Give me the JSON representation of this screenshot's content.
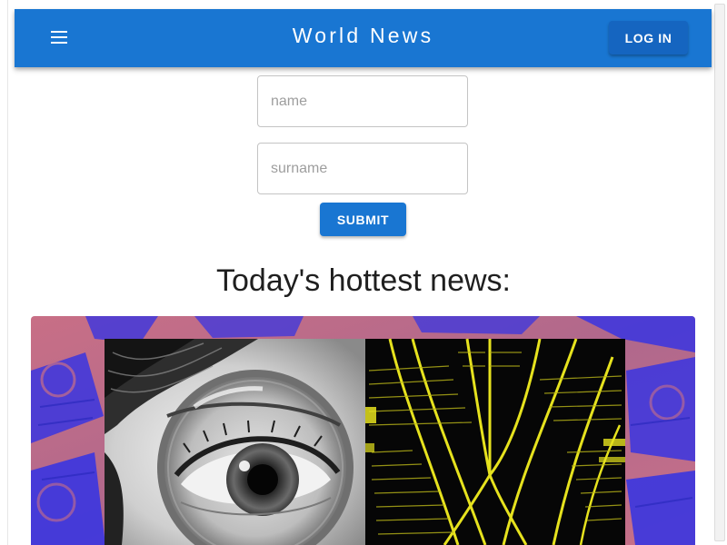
{
  "appbar": {
    "title": "World News",
    "login_label": "LOG IN",
    "menu_icon": "menu-icon",
    "color": "#1976d2"
  },
  "form": {
    "name_placeholder": "name",
    "name_value": "",
    "surname_placeholder": "surname",
    "surname_value": "",
    "submit_label": "SUBMIT"
  },
  "news": {
    "heading": "Today's hottest news:",
    "featured_image": "magnifying-glass-eye-and-rail-tracks-collage"
  },
  "colors": {
    "primary": "#1976d2",
    "collage_pink": "#c87088",
    "collage_blue": "#3a35e0",
    "collage_yellow": "#e6e21e"
  }
}
